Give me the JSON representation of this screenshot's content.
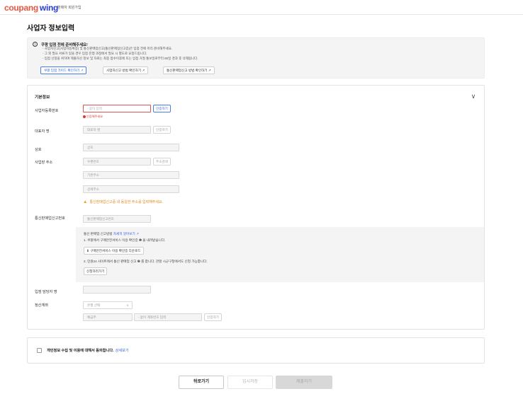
{
  "header": {
    "logo_coupang": "coupang",
    "logo_wing": "wing",
    "subtitle": "판매자 회원가입"
  },
  "page_title": "사업자 정보입력",
  "notice": {
    "title": "쿠팡 입점 전에 준비해주세요!",
    "lines": [
      "- 사업자신고(사업자등록증) 및 통신판매업신고(통신판매업신고증)은 입점 전에 미리 준비해주세요.",
      "- 그 외 필요 서류가 있을 경우 입점 진행 과정에서 필요 시 별도로 요청드립니다.",
      "- 입점 신청을 위하여 제출하신 정보 및 자료는 최종 접수이후에 또는 입점 거절 통보일로부터 90일 경과 후 삭제됩니다."
    ],
    "buttons": [
      "쿠팡 입점 가이드 확인하기 ↗",
      "사업자신고 방법 확인하기 ↗",
      "통신판매업신고 방법 확인하기 ↗"
    ]
  },
  "form": {
    "section_title": "기본정보",
    "collapse_icon": "∨",
    "business_number": {
      "label": "사업자등록번호",
      "placeholder": "- 없이 입력",
      "button": "인증하기",
      "error": "인증해주세요"
    },
    "representative": {
      "label": "대표자 명",
      "placeholder": "대표자 명",
      "button": "인증하기"
    },
    "company": {
      "label": "상호",
      "placeholder": "상호"
    },
    "address": {
      "label": "사업장 주소",
      "zip_placeholder": "우편번호",
      "search_button": "주소검색",
      "base_placeholder": "기본주소",
      "detail_placeholder": "상세주소",
      "warning": "통신판매업신고증 내 동일한 주소를 입력해주세요."
    },
    "mail_order": {
      "label": "통신판매업신고번호",
      "placeholder": "통신판매업신고번호"
    },
    "guide": {
      "title_prefix": "통신 판매업 신고방법 ",
      "title_link": "자세히 알아보기 ↗",
      "step1": "1. 쿠팡에서 구매안전서비스 이용 확인증 ❶ 을 내려받습니다.",
      "download_button": "⬇ 구매안전서비스 이용 확인증 다운로드",
      "step2": "2. 민원24 사이트에서 통신 판매업 신고 ❷ 를 합니다. 관할 시군구청에서도 신청 가능합니다.",
      "apply_button": "신청하러가기"
    },
    "manager": {
      "label": "입점 담당자 명",
      "placeholder": ""
    },
    "settlement": {
      "label": "정산계좌",
      "bank_placeholder": "은행 선택",
      "bank_arrow": "∨",
      "holder_placeholder": "예금주",
      "account_placeholder": "- 없이 계좌번호 입력",
      "button": "인증하기"
    }
  },
  "agreement": {
    "text": "개인정보 수집 및 이용에 대해서 동의합니다.",
    "link": "상세보기"
  },
  "footer": {
    "back": "뒤로가기",
    "save": "임시저장",
    "submit": "제출하기"
  },
  "colors": {
    "accent": "#2f5fd8",
    "error": "#d93a3a",
    "warning": "#e08a1e"
  }
}
